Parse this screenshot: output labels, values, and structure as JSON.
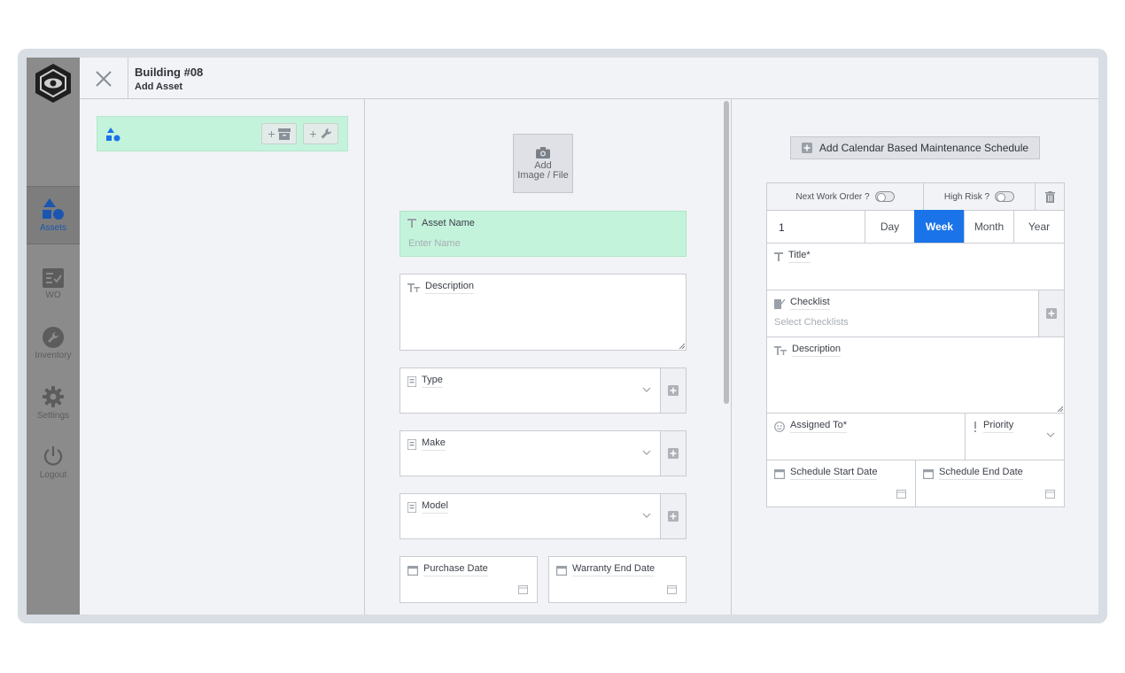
{
  "nav": {
    "items": [
      {
        "label": "Assets",
        "icon": "shapes-icon",
        "active": true
      },
      {
        "label": "WO",
        "icon": "checklist-icon"
      },
      {
        "label": "Inventory",
        "icon": "wrench-icon"
      },
      {
        "label": "Settings",
        "icon": "gear-icon"
      },
      {
        "label": "Logout",
        "icon": "power-icon"
      }
    ]
  },
  "header": {
    "title": "Building #08",
    "subtitle": "Add Asset"
  },
  "form": {
    "add_image_line1": "Add",
    "add_image_line2": "Image / File",
    "asset_name_label": "Asset Name",
    "asset_name_placeholder": "Enter Name",
    "description_label": "Description",
    "type_label": "Type",
    "make_label": "Make",
    "model_label": "Model",
    "purchase_date_label": "Purchase Date",
    "warranty_end_label": "Warranty End Date"
  },
  "schedule": {
    "add_button_label": "Add Calendar Based Maintenance Schedule",
    "next_work_order_label": "Next Work Order ?",
    "high_risk_label": "High Risk ?",
    "interval_value": "1",
    "periods": [
      "Day",
      "Week",
      "Month",
      "Year"
    ],
    "selected_period": "Week",
    "title_label": "Title*",
    "checklist_label": "Checklist",
    "checklist_placeholder": "Select Checklists",
    "description_label": "Description",
    "assigned_to_label": "Assigned To*",
    "priority_label": "Priority",
    "start_date_label": "Schedule Start Date",
    "end_date_label": "Schedule End Date"
  },
  "colors": {
    "accent": "#1a73e8",
    "highlight_green": "#c4f3dc",
    "sidebar": "#8b8b8b"
  }
}
